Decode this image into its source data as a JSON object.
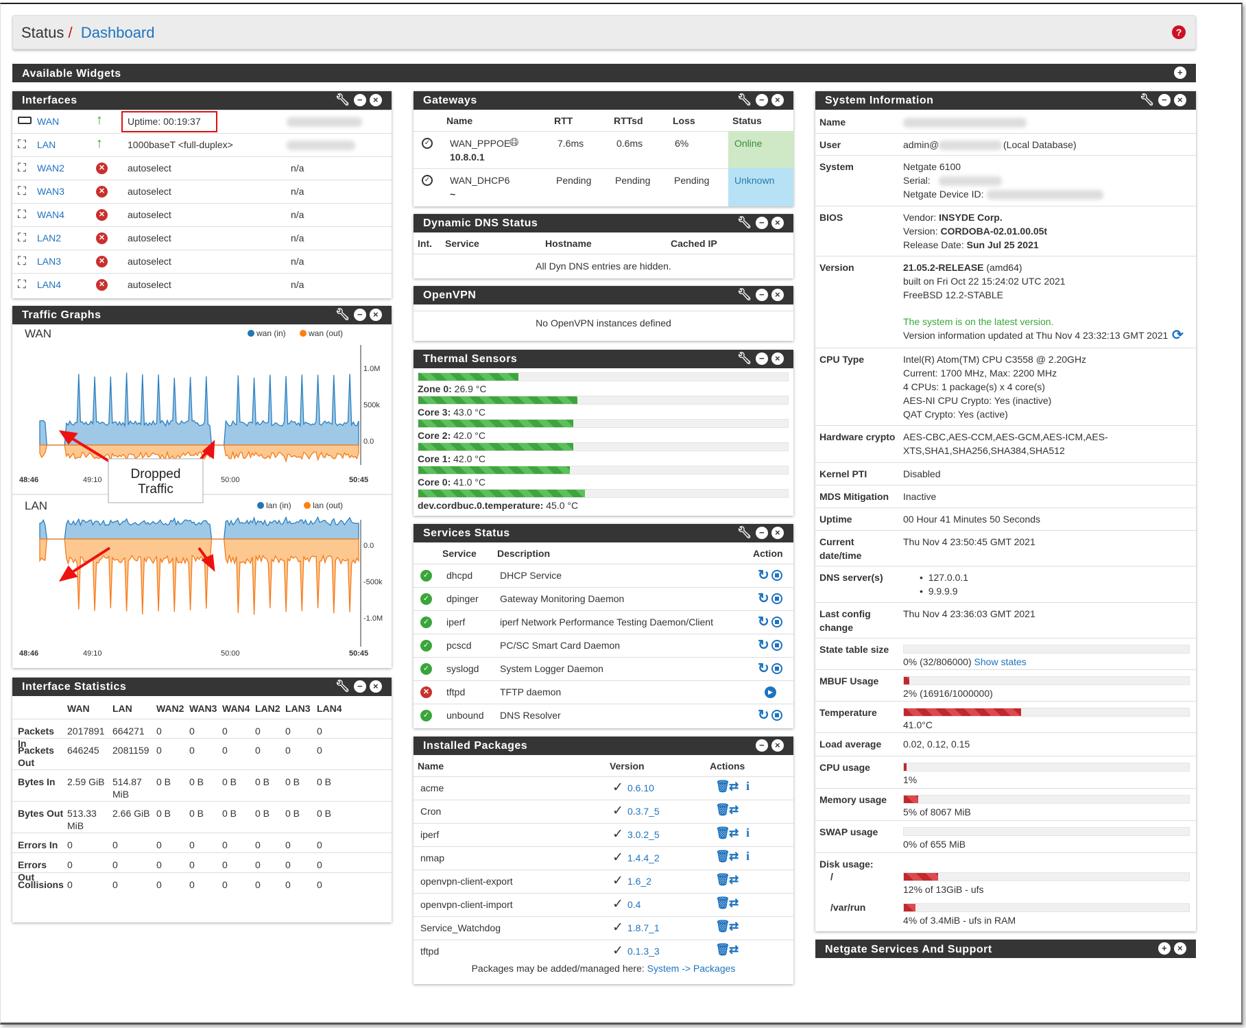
{
  "breadcrumb": {
    "status": "Status",
    "sep": "/",
    "page": "Dashboard",
    "help": "?"
  },
  "available_widgets": {
    "title": "Available Widgets",
    "add": "+"
  },
  "interfaces": {
    "title": "Interfaces",
    "rows": [
      {
        "name": "WAN",
        "up": true,
        "info": "Uptime: 00:19:37",
        "addr": ""
      },
      {
        "name": "LAN",
        "up": true,
        "info": "1000baseT <full-duplex>",
        "addr": ""
      },
      {
        "name": "WAN2",
        "up": false,
        "info": "autoselect",
        "addr": "n/a"
      },
      {
        "name": "WAN3",
        "up": false,
        "info": "autoselect",
        "addr": "n/a"
      },
      {
        "name": "WAN4",
        "up": false,
        "info": "autoselect",
        "addr": "n/a"
      },
      {
        "name": "LAN2",
        "up": false,
        "info": "autoselect",
        "addr": "n/a"
      },
      {
        "name": "LAN3",
        "up": false,
        "info": "autoselect",
        "addr": "n/a"
      },
      {
        "name": "LAN4",
        "up": false,
        "info": "autoselect",
        "addr": "n/a"
      }
    ]
  },
  "traffic_graphs": {
    "title": "Traffic Graphs",
    "callout": [
      "Dropped",
      "Traffic"
    ],
    "wan": {
      "name": "WAN",
      "legend_in": "wan (in)",
      "legend_out": "wan (out)",
      "y": [
        "1.0M",
        "500k",
        "0.0"
      ],
      "x": [
        "48:46",
        "49:10",
        "50:00",
        "50:45"
      ]
    },
    "lan": {
      "name": "LAN",
      "legend_in": "lan (in)",
      "legend_out": "lan (out)",
      "y": [
        "0.0",
        "-500k",
        "-1.0M"
      ],
      "x": [
        "48:46",
        "49:10",
        "50:00",
        "50:45"
      ]
    }
  },
  "interface_stats": {
    "title": "Interface Statistics",
    "cols": [
      "WAN",
      "LAN",
      "WAN2",
      "WAN3",
      "WAN4",
      "LAN2",
      "LAN3",
      "LAN4"
    ],
    "rows": [
      {
        "label": "Packets In",
        "vals": [
          "2017891",
          "664271",
          "0",
          "0",
          "0",
          "0",
          "0",
          "0"
        ]
      },
      {
        "label": "Packets Out",
        "vals": [
          "646245",
          "2081159",
          "0",
          "0",
          "0",
          "0",
          "0",
          "0"
        ]
      },
      {
        "label": "Bytes In",
        "vals": [
          "2.59 GiB",
          "514.87 MiB",
          "0 B",
          "0 B",
          "0 B",
          "0 B",
          "0 B",
          "0 B"
        ]
      },
      {
        "label": "Bytes Out",
        "vals": [
          "513.33 MiB",
          "2.66 GiB",
          "0 B",
          "0 B",
          "0 B",
          "0 B",
          "0 B",
          "0 B"
        ]
      },
      {
        "label": "Errors In",
        "vals": [
          "0",
          "0",
          "0",
          "0",
          "0",
          "0",
          "0",
          "0"
        ]
      },
      {
        "label": "Errors Out",
        "vals": [
          "0",
          "0",
          "0",
          "0",
          "0",
          "0",
          "0",
          "0"
        ]
      },
      {
        "label": "Collisions",
        "vals": [
          "0",
          "0",
          "0",
          "0",
          "0",
          "0",
          "0",
          "0"
        ]
      }
    ]
  },
  "gateways": {
    "title": "Gateways",
    "cols": [
      "Name",
      "RTT",
      "RTTsd",
      "Loss",
      "Status"
    ],
    "rows": [
      {
        "name": "WAN_PPPOE",
        "addr": "10.8.0.1",
        "rtt": "7.6ms",
        "rttsd": "0.6ms",
        "loss": "6%",
        "status": "Online"
      },
      {
        "name": "WAN_DHCP6",
        "addr": "~",
        "rtt": "Pending",
        "rttsd": "Pending",
        "loss": "Pending",
        "status": "Unknown"
      }
    ]
  },
  "ddns": {
    "title": "Dynamic DNS Status",
    "cols": [
      "Int.",
      "Service",
      "Hostname",
      "Cached IP"
    ],
    "msg": "All Dyn DNS entries are hidden."
  },
  "openvpn": {
    "title": "OpenVPN",
    "msg": "No OpenVPN instances defined"
  },
  "thermal": {
    "title": "Thermal Sensors",
    "sensors": [
      {
        "label": "Zone 0:",
        "value": "26.9 °C",
        "pct": 27
      },
      {
        "label": "Core 3:",
        "value": "43.0 °C",
        "pct": 43
      },
      {
        "label": "Core 2:",
        "value": "42.0 °C",
        "pct": 42
      },
      {
        "label": "Core 1:",
        "value": "42.0 °C",
        "pct": 42
      },
      {
        "label": "Core 0:",
        "value": "41.0 °C",
        "pct": 41
      },
      {
        "label": "dev.cordbuc.0.temperature:",
        "value": "45.0 °C",
        "pct": 45
      }
    ]
  },
  "services": {
    "title": "Services Status",
    "cols": [
      "Service",
      "Description",
      "Action"
    ],
    "rows": [
      {
        "name": "dhcpd",
        "desc": "DHCP Service",
        "running": true
      },
      {
        "name": "dpinger",
        "desc": "Gateway Monitoring Daemon",
        "running": true
      },
      {
        "name": "iperf",
        "desc": "iperf Network Performance Testing Daemon/Client",
        "running": true
      },
      {
        "name": "pcscd",
        "desc": "PC/SC Smart Card Daemon",
        "running": true
      },
      {
        "name": "syslogd",
        "desc": "System Logger Daemon",
        "running": true
      },
      {
        "name": "tftpd",
        "desc": "TFTP daemon",
        "running": false
      },
      {
        "name": "unbound",
        "desc": "DNS Resolver",
        "running": true
      }
    ]
  },
  "packages": {
    "title": "Installed Packages",
    "cols": [
      "Name",
      "Version",
      "Actions"
    ],
    "rows": [
      {
        "name": "acme",
        "ver": "0.6.10",
        "info": true
      },
      {
        "name": "Cron",
        "ver": "0.3.7_5",
        "info": false
      },
      {
        "name": "iperf",
        "ver": "3.0.2_5",
        "info": true
      },
      {
        "name": "nmap",
        "ver": "1.4.4_2",
        "info": true
      },
      {
        "name": "openvpn-client-export",
        "ver": "1.6_2",
        "info": false
      },
      {
        "name": "openvpn-client-import",
        "ver": "0.4",
        "info": false
      },
      {
        "name": "Service_Watchdog",
        "ver": "1.8.7_1",
        "info": false
      },
      {
        "name": "tftpd",
        "ver": "0.1.3_3",
        "info": false
      }
    ],
    "footer": "Packages may be added/managed here:",
    "footer_link": "System -> Packages"
  },
  "sysinfo": {
    "title": "System Information",
    "name_label": "Name",
    "user_label": "User",
    "user_a": "admin@",
    "user_b": "(Local Database)",
    "system_label": "System",
    "system": [
      "Netgate 6100",
      "Serial:",
      "Netgate Device ID:"
    ],
    "bios_label": "BIOS",
    "bios": [
      [
        "Vendor: ",
        "INSYDE Corp."
      ],
      [
        "Version: ",
        "CORDOBA-02.01.00.05t"
      ],
      [
        "Release Date: ",
        "Sun Jul 25 2021"
      ]
    ],
    "version_label": "Version",
    "version_bold": "21.05.2-RELEASE",
    "version_arch": " (amd64)",
    "version_lines": [
      "built on Fri Oct 22 15:24:02 UTC 2021",
      "FreeBSD 12.2-STABLE"
    ],
    "version_latest": "The system is on the latest version.",
    "version_updated": "Version information updated at Thu Nov 4 23:32:13 GMT 2021",
    "cpu_label": "CPU Type",
    "cpu": [
      "Intel(R) Atom(TM) CPU C3558 @ 2.20GHz",
      "Current: 1700 MHz, Max: 2200 MHz",
      "4 CPUs: 1 package(s) x 4 core(s)",
      "AES-NI CPU Crypto: Yes (inactive)",
      "QAT Crypto: Yes (active)"
    ],
    "hwc_label": "Hardware crypto",
    "hwc": [
      "AES-CBC,AES-CCM,AES-GCM,AES-ICM,AES-",
      "XTS,SHA1,SHA256,SHA384,SHA512"
    ],
    "pti_label": "Kernel PTI",
    "pti": "Disabled",
    "mds_label": "MDS Mitigation",
    "mds": "Inactive",
    "uptime_label": "Uptime",
    "uptime": "00 Hour 41 Minutes 50 Seconds",
    "dt_label": [
      "Current",
      "date/time"
    ],
    "dt": "Thu Nov 4 23:50:45 GMT 2021",
    "dns_label": "DNS server(s)",
    "dns": [
      "127.0.0.1",
      "9.9.9.9"
    ],
    "lc_label": [
      "Last config",
      "change"
    ],
    "lc": "Thu Nov 4 23:36:03 GMT 2021",
    "state_label": "State table size",
    "state": "0% (32/806000)",
    "state_link": "Show states",
    "state_pct": 0,
    "mbuf_label": "MBUF Usage",
    "mbuf": "2% (16916/1000000)",
    "mbuf_pct": 2,
    "temp_label": "Temperature",
    "temp": "41.0°C",
    "temp_pct": 41,
    "load_label": "Load average",
    "load": "0.02, 0.12, 0.15",
    "cpu_usage_label": "CPU usage",
    "cpu_usage": "1%",
    "cpu_usage_pct": 1,
    "mem_label": "Memory usage",
    "mem": "5% of 8067 MiB",
    "mem_pct": 5,
    "swap_label": "SWAP usage",
    "swap": "0% of 655 MiB",
    "swap_pct": 0,
    "disk_label": "Disk usage:",
    "disk_root": "/",
    "disk_root_val": "12% of 13GiB - ufs",
    "disk_root_pct": 12,
    "disk_var": "/var/run",
    "disk_var_val": "4% of 3.4MiB - ufs in RAM",
    "disk_var_pct": 4
  },
  "netgate": {
    "title": "Netgate Services And Support"
  }
}
